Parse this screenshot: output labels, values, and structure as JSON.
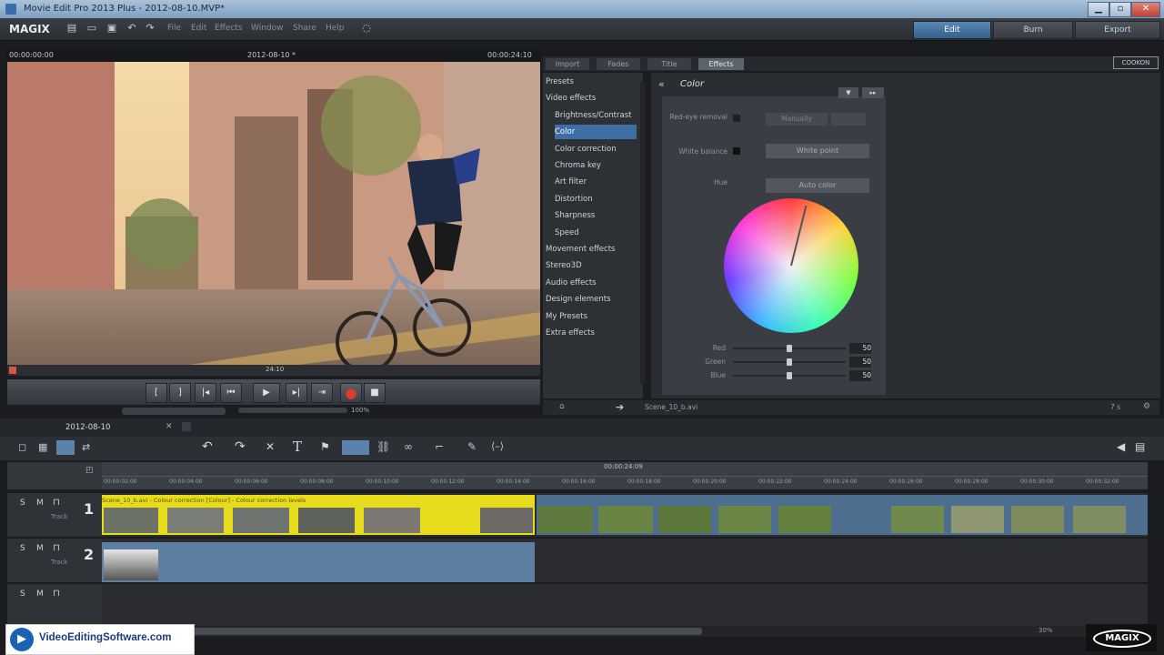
{
  "window": {
    "title": "Movie Edit Pro 2013 Plus - 2012-08-10.MVP*"
  },
  "menubar": {
    "logo": "MAGIX",
    "menus": [
      "File",
      "Edit",
      "Effects",
      "Window",
      "Share",
      "Help"
    ],
    "modes": [
      "Edit",
      "Burn",
      "Export"
    ]
  },
  "monitor": {
    "time_left": "00:00:00:00",
    "project": "2012-08-10 *",
    "time_right": "00:00:24:10",
    "scrub_time": "24:10",
    "zoom": "100%"
  },
  "media_pool": {
    "tabs": [
      "Import",
      "Fades",
      "Title",
      "Effects"
    ],
    "active_tab": "Effects",
    "brand": "COOKON",
    "tree": [
      {
        "label": "Presets",
        "level": 0
      },
      {
        "label": "Video effects",
        "level": 0
      },
      {
        "label": "Brightness/Contrast",
        "level": 1
      },
      {
        "label": "Color",
        "level": 1,
        "selected": true
      },
      {
        "label": "Color correction",
        "level": 1
      },
      {
        "label": "Chroma key",
        "level": 1
      },
      {
        "label": "Art filter",
        "level": 1
      },
      {
        "label": "Distortion",
        "level": 1
      },
      {
        "label": "Sharpness",
        "level": 1
      },
      {
        "label": "Speed",
        "level": 1
      },
      {
        "label": "Movement effects",
        "level": 0
      },
      {
        "label": "Stereo3D",
        "level": 0
      },
      {
        "label": "Audio effects",
        "level": 0
      },
      {
        "label": "Design elements",
        "level": 0
      },
      {
        "label": "My Presets",
        "level": 0
      },
      {
        "label": "Extra effects",
        "level": 0
      }
    ],
    "footer_file": "Scene_10_b.avi",
    "footer_count": "7 s"
  },
  "color_panel": {
    "title": "Color",
    "red_eye_label": "Red-eye removal",
    "manually_label": "Manually",
    "white_balance_label": "White balance",
    "white_point_label": "White point",
    "hue_label": "Hue",
    "auto_color_label": "Auto color",
    "sliders": [
      {
        "label": "Red",
        "value": 50
      },
      {
        "label": "Green",
        "value": 50
      },
      {
        "label": "Blue",
        "value": 50
      }
    ]
  },
  "timeline": {
    "tab": "2012-08-10",
    "ruler_center": "00:00:24:09",
    "ruler_ticks": [
      "00:00:02:00",
      "00:00:04:00",
      "00:00:06:00",
      "00:00:08:00",
      "00:00:10:00",
      "00:00:12:00",
      "00:00:14:00",
      "00:00:16:00",
      "00:00:18:00",
      "00:00:20:00",
      "00:00:22:00",
      "00:00:24:00",
      "00:00:26:00",
      "00:00:28:00",
      "00:00:30:00",
      "00:00:32:00"
    ],
    "tracks": [
      {
        "num": "1",
        "name": "Track",
        "clip_label": "Scene_10_b.avi - Colour correction [Colour] - Colour correction levels"
      },
      {
        "num": "2",
        "name": "Track"
      },
      {
        "num": "",
        "name": ""
      }
    ],
    "zoom": "30%"
  },
  "watermark": {
    "site": "VideoEditingSoftware.com",
    "brand": "MAGIX"
  }
}
